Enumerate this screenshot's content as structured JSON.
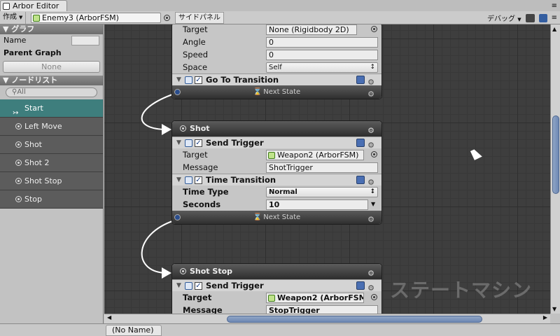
{
  "window": {
    "tab_title": "Arbor Editor",
    "menu_icon": "menu-icon"
  },
  "toolbar": {
    "create_label": "作成",
    "graph_field": "Enemy3 (ArborFSM)",
    "side_panel_label": "サイドパネル",
    "debug_label": "デバッグ"
  },
  "sidebar": {
    "graph_section": "グラフ",
    "name_label": "Name",
    "name_value": "",
    "parent_graph_label": "Parent Graph",
    "parent_graph_value": "None",
    "nodelist_section": "ノードリスト",
    "search_placeholder": "All",
    "nodes": [
      "Start",
      "Left Move",
      "Shot",
      "Shot 2",
      "Shot Stop",
      "Stop"
    ],
    "selected_node": "Start"
  },
  "canvas": {
    "watermark": "ステートマシン",
    "node_top": {
      "props": [
        {
          "label": "Target",
          "value": "None (Rigidbody 2D)"
        },
        {
          "label": "Angle",
          "value": "0"
        },
        {
          "label": "Speed",
          "value": "0"
        },
        {
          "label": "Space",
          "value": "Self"
        }
      ],
      "behaviour": "Go To Transition",
      "transition": "Next State"
    },
    "node_shot": {
      "title": "Shot",
      "behaviour1": "Send Trigger",
      "b1_props": [
        {
          "label": "Target",
          "value": "Weapon2 (ArborFSM)"
        },
        {
          "label": "Message",
          "value": "ShotTrigger"
        }
      ],
      "behaviour2": "Time Transition",
      "b2_props": [
        {
          "label": "Time Type",
          "value": "Normal"
        },
        {
          "label": "Seconds",
          "value": "10"
        }
      ],
      "transition": "Next State"
    },
    "node_shotstop": {
      "title": "Shot Stop",
      "behaviour": "Send Trigger",
      "props": [
        {
          "label": "Target",
          "value": "Weapon2 (ArborFSM)"
        },
        {
          "label": "Message",
          "value": "StopTrigger"
        }
      ]
    }
  },
  "status": {
    "label": "(No Name)"
  },
  "colors": {
    "selected_node": "#3e7e7d",
    "canvas_bg": "#3e3e3e",
    "header": "#6e6e6e"
  }
}
